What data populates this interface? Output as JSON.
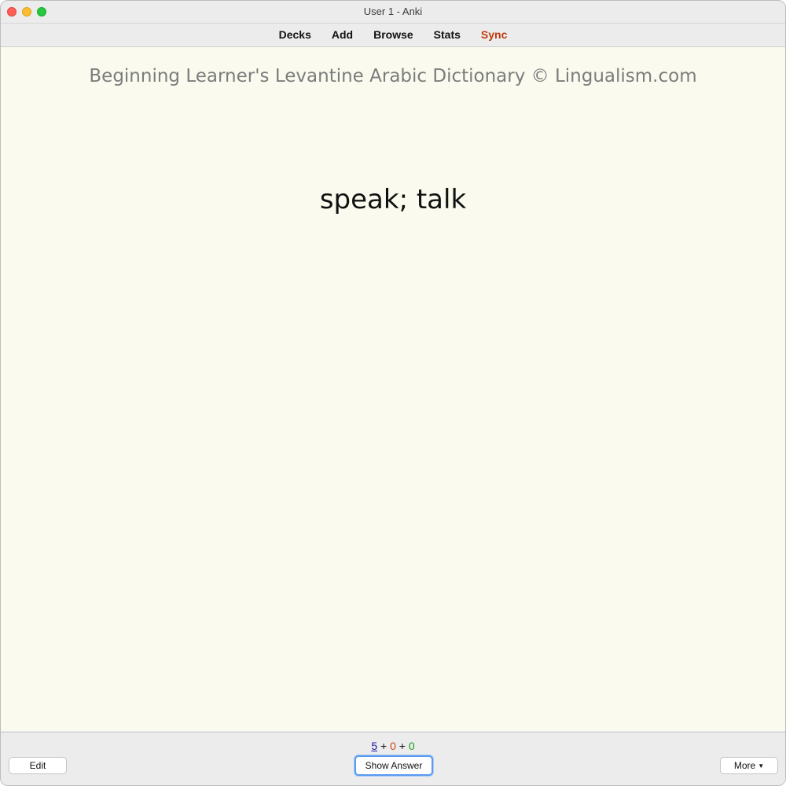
{
  "window": {
    "title": "User 1 - Anki"
  },
  "toolbar": {
    "items": [
      {
        "label": "Decks"
      },
      {
        "label": "Add"
      },
      {
        "label": "Browse"
      },
      {
        "label": "Stats"
      },
      {
        "label": "Sync"
      }
    ]
  },
  "card": {
    "header": "Beginning Learner's Levantine Arabic Dictionary © Lingualism.com",
    "front": "speak; talk"
  },
  "bottom": {
    "counts": {
      "new": "5",
      "plus1": "+",
      "learn": "0",
      "plus2": "+",
      "review": "0"
    },
    "edit_label": "Edit",
    "show_answer_label": "Show Answer",
    "more_label": "More",
    "more_icon": "caret-down-icon"
  },
  "colors": {
    "sync": "#c03a0e",
    "card_background": "#fafbee",
    "new_count": "#1a1aaa",
    "learn_count": "#c9450f",
    "review_count": "#14a01e",
    "focus_ring": "#5a9bf0"
  }
}
